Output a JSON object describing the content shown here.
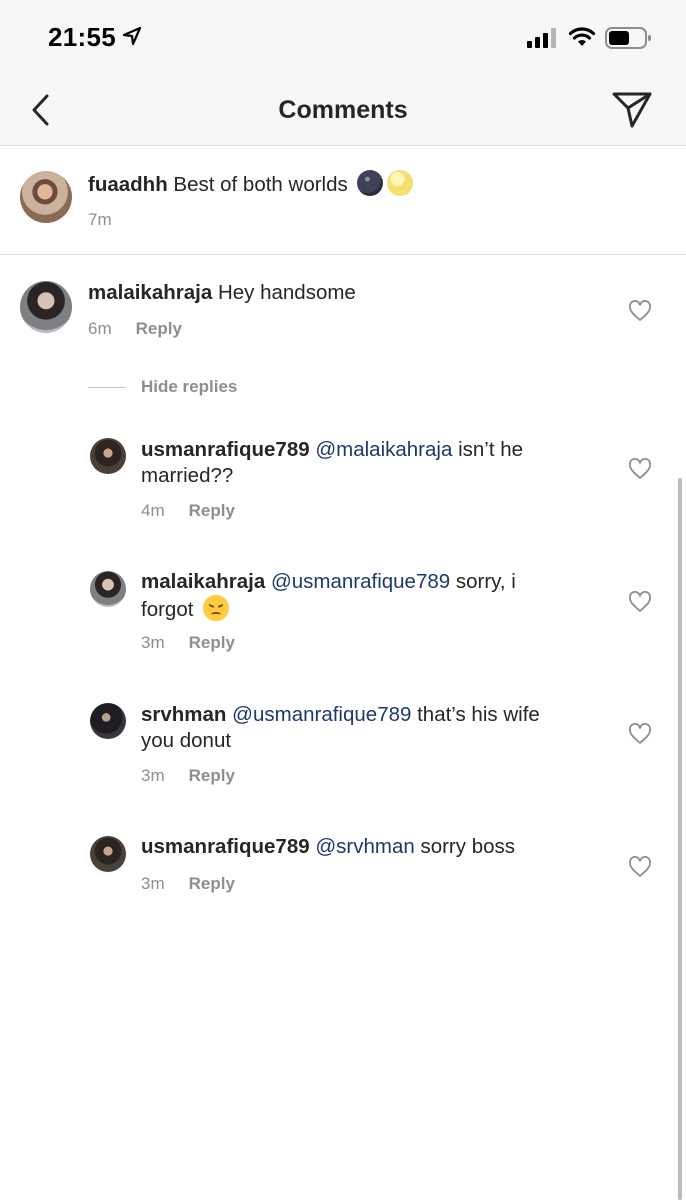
{
  "status_bar": {
    "time": "21:55",
    "icons": [
      "location-arrow-icon",
      "signal-icon",
      "wifi-icon",
      "battery-icon"
    ]
  },
  "header": {
    "title": "Comments",
    "back_icon": "chevron-left-icon",
    "send_icon": "paper-plane-icon"
  },
  "caption": {
    "username": "fuaadhh",
    "text": "Best of both worlds",
    "emojis": [
      "new-moon-face",
      "full-moon-face"
    ],
    "time": "7m"
  },
  "comments": [
    {
      "username": "malaikahraja",
      "text": "Hey handsome",
      "time": "6m",
      "reply_label": "Reply",
      "hide_replies_label": "Hide replies",
      "replies": [
        {
          "username": "usmanrafique789",
          "mention": "@malaikahraja",
          "text_line1": "isn’t he",
          "text_line2": "married??",
          "time": "4m",
          "reply_label": "Reply"
        },
        {
          "username": "malaikahraja",
          "mention": "@usmanrafique789",
          "text_line1": "sorry, i",
          "text_line2": "forgot",
          "emoji": "disappointed-face",
          "time": "3m",
          "reply_label": "Reply"
        },
        {
          "username": "srvhman",
          "mention": "@usmanrafique789",
          "text_line1": "that’s his wife",
          "text_line2": "you donut",
          "time": "3m",
          "reply_label": "Reply"
        },
        {
          "username": "usmanrafique789",
          "mention": "@srvhman",
          "text_line1": "sorry boss",
          "time": "3m",
          "reply_label": "Reply"
        }
      ]
    }
  ],
  "colors": {
    "text": "#262626",
    "secondary": "#8e8e8e",
    "mention": "#1b3a6b",
    "bar_background": "#f7f7f7"
  }
}
